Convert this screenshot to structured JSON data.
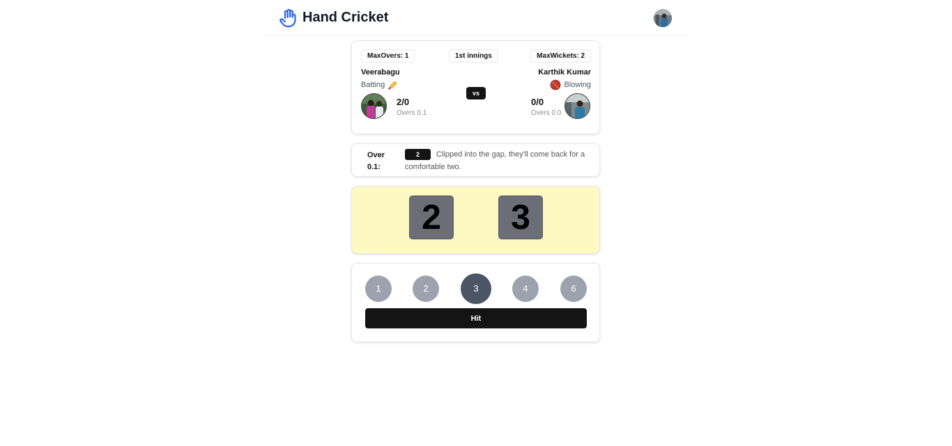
{
  "header": {
    "title": "Hand Cricket",
    "logo_icon": "hand-icon",
    "accent_color": "#2563eb"
  },
  "match": {
    "max_overs_label": "MaxOvers: 1",
    "innings_label": "1st innings",
    "max_wickets_label": "MaxWickets: 2",
    "vs_label": "vs",
    "batter": {
      "name": "Veerabagu",
      "role": "Batting",
      "role_icon": "cricket-bat-icon",
      "score": "2/0",
      "overs": "Overs 0.1"
    },
    "bowler": {
      "name": "Karthik Kumar",
      "role": "Blowing",
      "role_icon": "cricket-ball-icon",
      "score": "0/0",
      "overs": "Overs 0.0"
    }
  },
  "commentary": {
    "over_label": "Over 0.1:",
    "runs": "2",
    "text": "Clipped into the gap, they'll come back for a comfortable two."
  },
  "hands": {
    "batter_value": "2",
    "bowler_value": "3",
    "background": "#fef9c3"
  },
  "controls": {
    "choices": [
      "1",
      "2",
      "3",
      "4",
      "6"
    ],
    "selected": "3",
    "hit_label": "Hit"
  }
}
